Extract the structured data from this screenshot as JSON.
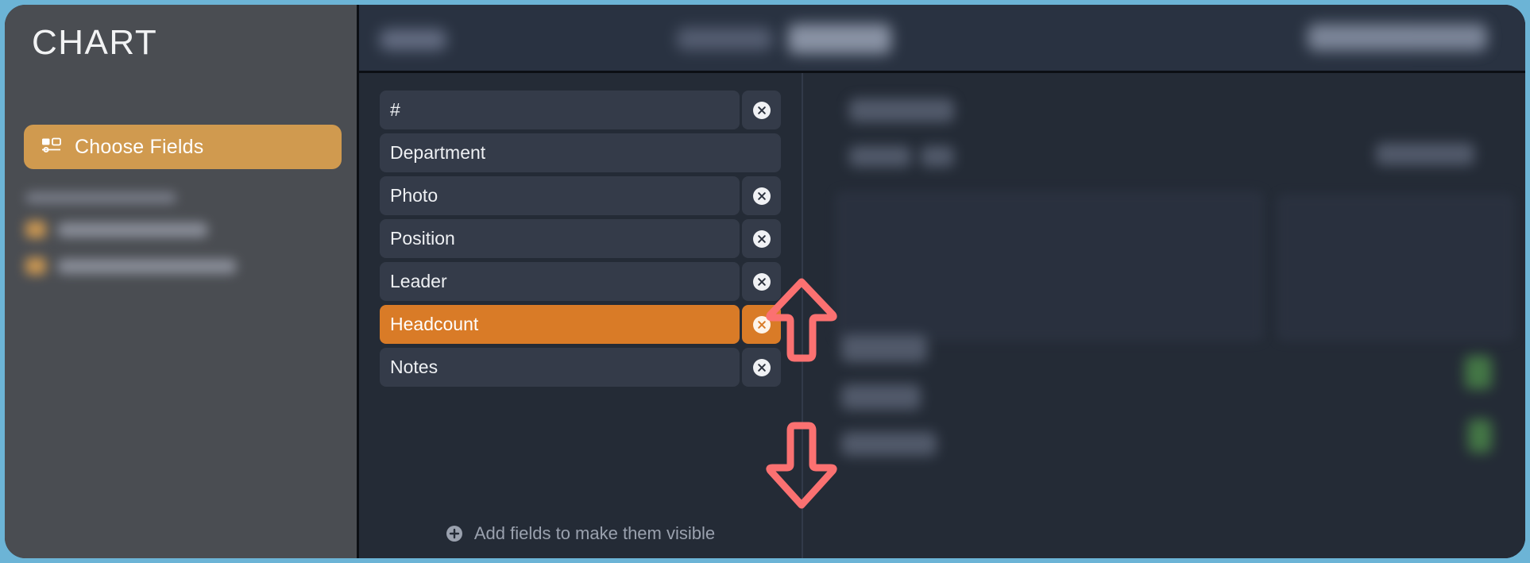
{
  "window": {
    "accent_frame_color": "#6cb4d6",
    "panel_background": "#242b36",
    "sidebar_background": "#4a4d52"
  },
  "sidebar": {
    "title": "CHART",
    "choose_fields": {
      "label": "Choose Fields",
      "icon": "fields-icon",
      "background_color": "#d09a4f",
      "active": true
    },
    "blurred_group_label": "",
    "blurred_items": [
      {
        "label": "",
        "chip_color": "#cf9a53"
      },
      {
        "label": "",
        "chip_color": "#cf9a53"
      }
    ]
  },
  "header": {
    "breadcrumb": "",
    "tabs": [
      {
        "label": "",
        "active": false
      },
      {
        "label": "",
        "active": true
      }
    ],
    "action_button": ""
  },
  "field_panel": {
    "selected_color": "#d97b27",
    "row_color": "#343b49",
    "fields": [
      {
        "label": "#",
        "removable": true,
        "selected": false
      },
      {
        "label": "Department",
        "removable": false,
        "selected": false
      },
      {
        "label": "Photo",
        "removable": true,
        "selected": false
      },
      {
        "label": "Position",
        "removable": true,
        "selected": false
      },
      {
        "label": "Leader",
        "removable": true,
        "selected": false
      },
      {
        "label": "Headcount",
        "removable": true,
        "selected": true
      },
      {
        "label": "Notes",
        "removable": true,
        "selected": false
      }
    ],
    "add_fields": {
      "label": "Add fields to make them visible",
      "icon": "plus-circle-icon"
    },
    "remove_icon": "close-circle-icon"
  },
  "annotations": {
    "color": "#fb7171",
    "arrows": [
      {
        "name": "move-up-arrow",
        "direction": "up"
      },
      {
        "name": "move-down-arrow",
        "direction": "down"
      }
    ]
  }
}
